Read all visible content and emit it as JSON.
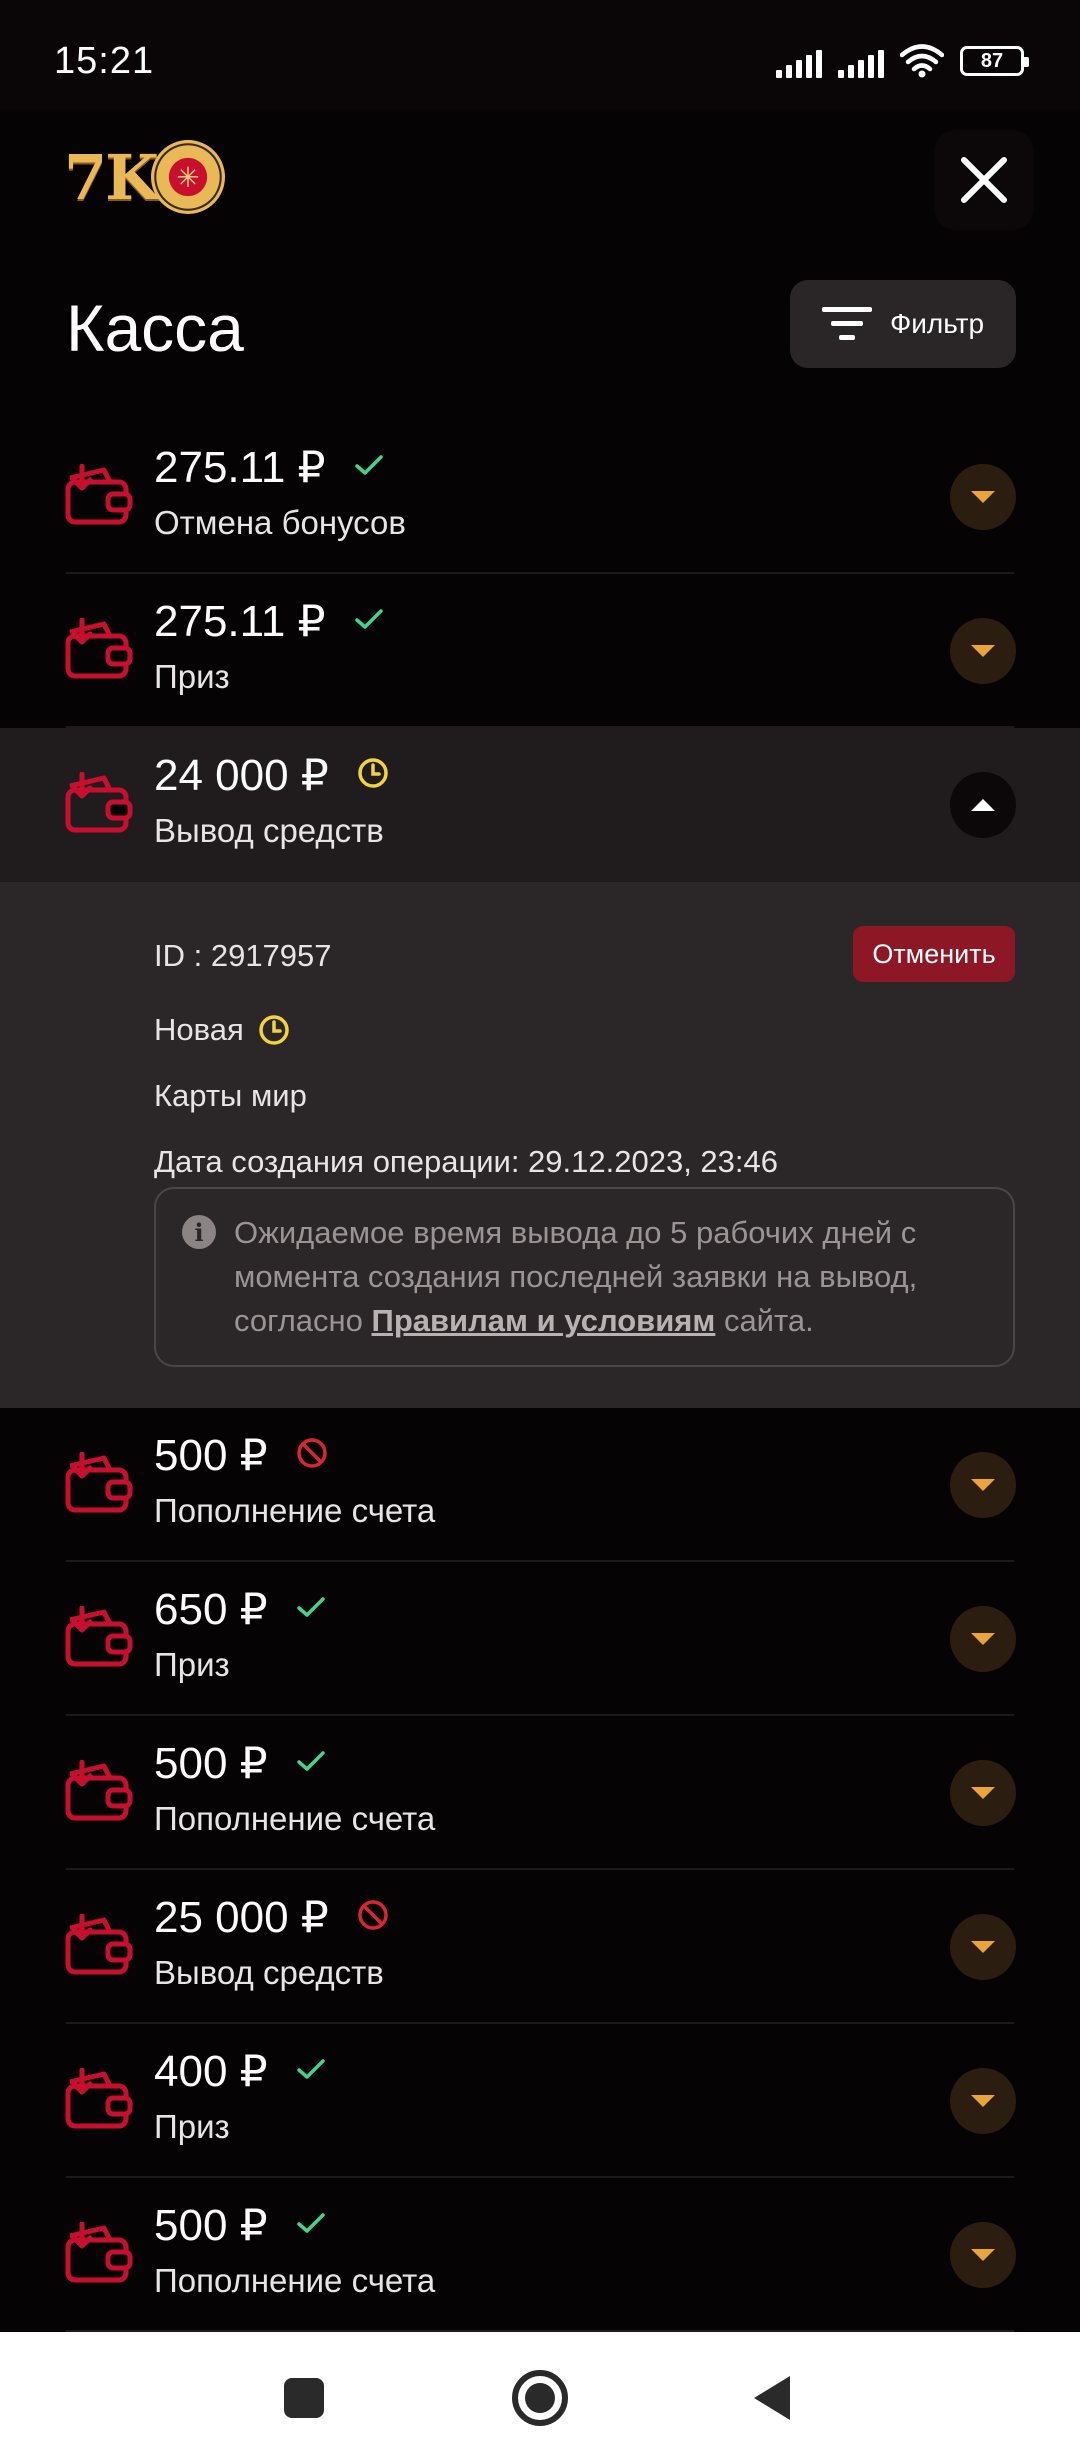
{
  "status_bar": {
    "time": "15:21",
    "battery": "87"
  },
  "header": {
    "logo_text": "7K",
    "title": "Касса",
    "filter_label": "Фильтр"
  },
  "colors": {
    "ok": "#3fd68a",
    "pending": "#f2d339",
    "rejected": "#d9262f",
    "arrow": "#e9a53a",
    "accent": "#c8102e"
  },
  "transactions": [
    {
      "amount": "275.11 ₽",
      "type": "Отмена бонусов",
      "status": "ok"
    },
    {
      "amount": "275.11 ₽",
      "type": "Приз",
      "status": "ok"
    },
    {
      "amount": "24 000 ₽",
      "type": "Вывод средств",
      "status": "pending",
      "expanded": true
    },
    {
      "amount": "500 ₽",
      "type": "Пополнение счета",
      "status": "rejected"
    },
    {
      "amount": "650 ₽",
      "type": "Приз",
      "status": "ok"
    },
    {
      "amount": "500 ₽",
      "type": "Пополнение счета",
      "status": "ok"
    },
    {
      "amount": "25 000 ₽",
      "type": "Вывод средств",
      "status": "rejected"
    },
    {
      "amount": "400 ₽",
      "type": "Приз",
      "status": "ok"
    },
    {
      "amount": "500 ₽",
      "type": "Пополнение счета",
      "status": "ok"
    }
  ],
  "details": {
    "id_text": "ID : 2917957",
    "cancel_label": "Отменить",
    "status_text": "Новая",
    "method": "Карты мир",
    "created": "Дата создания операции: 29.12.2023, 23:46",
    "info_before": "Ожидаемое время вывода до 5 рабочих дней с момента создания последней заявки на вывод, согласно ",
    "info_link": "Правилам и условиям",
    "info_after": " сайта."
  }
}
